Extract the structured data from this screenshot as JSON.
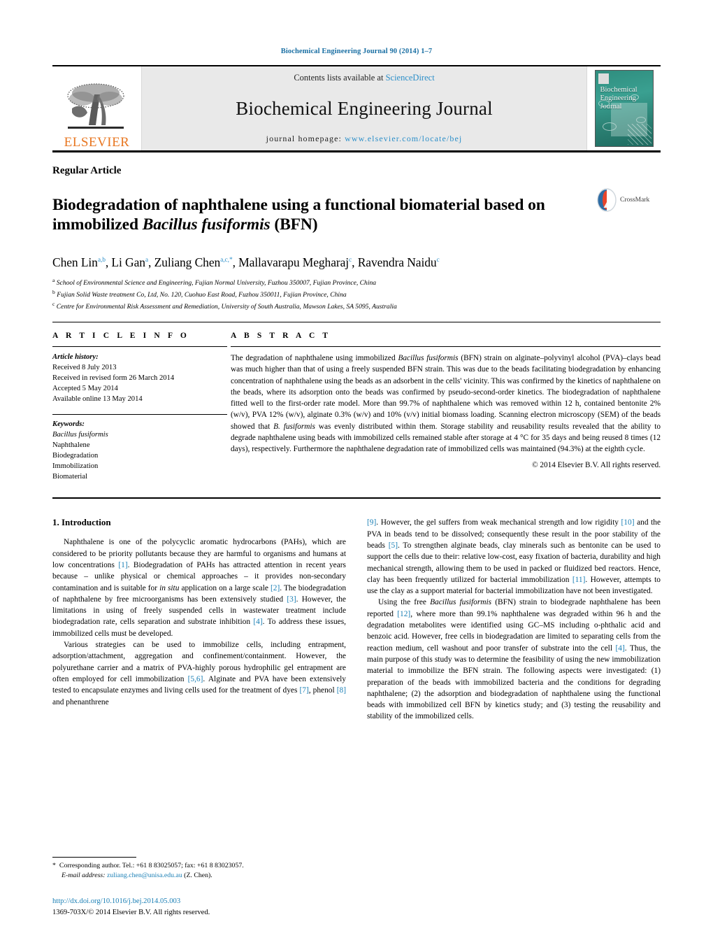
{
  "running_head": "Biochemical Engineering Journal 90 (2014) 1–7",
  "masthead": {
    "publisher_logo_text": "ELSEVIER",
    "contents_prefix": "Contents lists available at",
    "contents_link": "ScienceDirect",
    "journal_title": "Biochemical Engineering Journal",
    "homepage_prefix": "journal homepage:",
    "homepage_url": "www.elsevier.com/locate/bej",
    "cover_title_line1": "Biochemical",
    "cover_title_line2": "Engineering",
    "cover_title_line3": "Journal"
  },
  "article": {
    "category": "Regular Article",
    "title_part1": "Biodegradation of naphthalene using a functional biomaterial based on immobilized ",
    "title_italic": "Bacillus fusiformis",
    "title_part2": " (BFN)",
    "crossmark_label": "CrossMark",
    "authors_html": "Chen Lin<sup>a,b</sup>, Li Gan<sup>a</sup>, Zuliang Chen<sup>a,c,</sup><sup>*</sup>, Mallavarapu Megharaj<sup>c</sup>, Ravendra Naidu<sup>c</sup>",
    "affiliations": [
      {
        "marker": "a",
        "text": "School of Environmental Science and Engineering, Fujian Normal University, Fuzhou 350007, Fujian Province, China"
      },
      {
        "marker": "b",
        "text": "Fujian Solid Waste treatment Co, Ltd, No. 120, Cuohuo East Road, Fuzhou 350011, Fujian Province, China"
      },
      {
        "marker": "c",
        "text": "Centre for Environmental Risk Assessment and Remediation, University of South Australia, Mawson Lakes, SA 5095, Australia"
      }
    ]
  },
  "article_info": {
    "heading": "A R T I C L E  I N F O",
    "history_heading": "Article history:",
    "history": [
      "Received 8 July 2013",
      "Received in revised form 26 March 2014",
      "Accepted 5 May 2014",
      "Available online 13 May 2014"
    ],
    "keywords_heading": "Keywords:",
    "keywords_italic": "Bacillus fusiformis",
    "keywords": [
      "Naphthalene",
      "Biodegradation",
      "Immobilization",
      "Biomaterial"
    ]
  },
  "abstract": {
    "heading": "A B S T R A C T",
    "text_p1": "The degradation of naphthalene using immobilized ",
    "text_i1": "Bacillus fusiformis",
    "text_p2": " (BFN) strain on alginate–polyvinyl alcohol (PVA)–clays bead was much higher than that of using a freely suspended BFN strain. This was due to the beads facilitating biodegradation by enhancing concentration of naphthalene using the beads as an adsorbent in the cells' vicinity. This was confirmed by the kinetics of naphthalene on the beads, where its adsorption onto the beads was confirmed by pseudo-second-order kinetics. The biodegradation of naphthalene fitted well to the first-order rate model. More than 99.7% of naphthalene which was removed within 12 h, contained bentonite 2% (w/v), PVA 12% (w/v), alginate 0.3% (w/v) and 10% (v/v) initial biomass loading. Scanning electron microscopy (SEM) of the beads showed that ",
    "text_i2": "B. fusiformis",
    "text_p3": " was evenly distributed within them. Storage stability and reusability results revealed that the ability to degrade naphthalene using beads with immobilized cells remained stable after storage at 4 °C for 35 days and being reused 8 times (12 days), respectively. Furthermore the naphthalene degradation rate of immobilized cells was maintained (94.3%) at the eighth cycle.",
    "copyright": "© 2014 Elsevier B.V. All rights reserved."
  },
  "introduction": {
    "heading": "1. Introduction",
    "left_p1_a": "Naphthalene is one of the polycyclic aromatic hydrocarbons (PAHs), which are considered to be priority pollutants because they are harmful to organisms and humans at low concentrations ",
    "left_p1_r1": "[1]",
    "left_p1_b": ". Biodegradation of PAHs has attracted attention in recent years because – unlike physical or chemical approaches – it provides non-secondary contamination and is suitable for ",
    "left_p1_i": "in situ",
    "left_p1_c": " application on a large scale ",
    "left_p1_r2": "[2]",
    "left_p1_d": ". The biodegradation of naphthalene by free microorganisms has been extensively studied ",
    "left_p1_r3": "[3]",
    "left_p1_e": ". However, the limitations in using of freely suspended cells in wastewater treatment include biodegradation rate, cells separation and substrate inhibition ",
    "left_p1_r4": "[4]",
    "left_p1_f": ". To address these issues, immobilized cells must be developed.",
    "left_p2_a": "Various strategies can be used to immobilize cells, including entrapment, adsorption/attachment, aggregation and confinement/containment. However, the polyurethane carrier and a matrix of PVA-highly porous hydrophilic gel entrapment are often employed for cell immobilization ",
    "left_p2_r1": "[5,6]",
    "left_p2_b": ". Alginate and PVA have been extensively tested to encapsulate enzymes and living cells used for the treatment of dyes ",
    "left_p2_r2": "[7]",
    "left_p2_c": ", phenol ",
    "left_p2_r3": "[8]",
    "left_p2_d": " and phenanthrene",
    "right_p1_r0": "[9]",
    "right_p1_a": ". However, the gel suffers from weak mechanical strength and low rigidity ",
    "right_p1_r1": "[10]",
    "right_p1_b": " and the PVA in beads tend to be dissolved; consequently these result in the poor stability of the beads ",
    "right_p1_r2": "[5]",
    "right_p1_c": ". To strengthen alginate beads, clay minerals such as bentonite can be used to support the cells due to their: relative low-cost, easy fixation of bacteria, durability and high mechanical strength, allowing them to be used in packed or fluidized bed reactors. Hence, clay has been frequently utilized for bacterial immobilization ",
    "right_p1_r3": "[11]",
    "right_p1_d": ". However, attempts to use the clay as a support material for bacterial immobilization have not been investigated.",
    "right_p2_a": "Using the free ",
    "right_p2_i": "Bacillus fusiformis",
    "right_p2_b": " (BFN) strain to biodegrade naphthalene has been reported ",
    "right_p2_r1": "[12]",
    "right_p2_c": ", where more than 99.1% naphthalene was degraded within 96 h and the degradation metabolites were identified using GC–MS including o-phthalic acid and benzoic acid. However, free cells in biodegradation are limited to separating cells from the reaction medium, cell washout and poor transfer of substrate into the cell ",
    "right_p2_r2": "[4]",
    "right_p2_d": ". Thus, the main purpose of this study was to determine the feasibility of using the new immobilization material to immobilize the BFN strain. The following aspects were investigated: (1) preparation of the beads with immobilized bacteria and the conditions for degrading naphthalene; (2) the adsorption and biodegradation of naphthalene using the functional beads with immobilized cell BFN by kinetics study; and (3) testing the reusability and stability of the immobilized cells."
  },
  "footnote": {
    "star": "*",
    "corresponding": "Corresponding author. Tel.: +61 8 83025057; fax: +61 8 83023057.",
    "email_label": "E-mail address:",
    "email": "zuliang.chen@unisa.edu.au",
    "email_suffix": " (Z. Chen)."
  },
  "footer": {
    "doi": "http://dx.doi.org/10.1016/j.bej.2014.05.003",
    "issn": "1369-703X/© 2014 Elsevier B.V. All rights reserved."
  },
  "colors": {
    "link": "#1a7fb5",
    "elsevier_orange": "#E87722",
    "sciencedirect_blue": "#2c8fc9",
    "band_gray": "#e9e9e9"
  }
}
